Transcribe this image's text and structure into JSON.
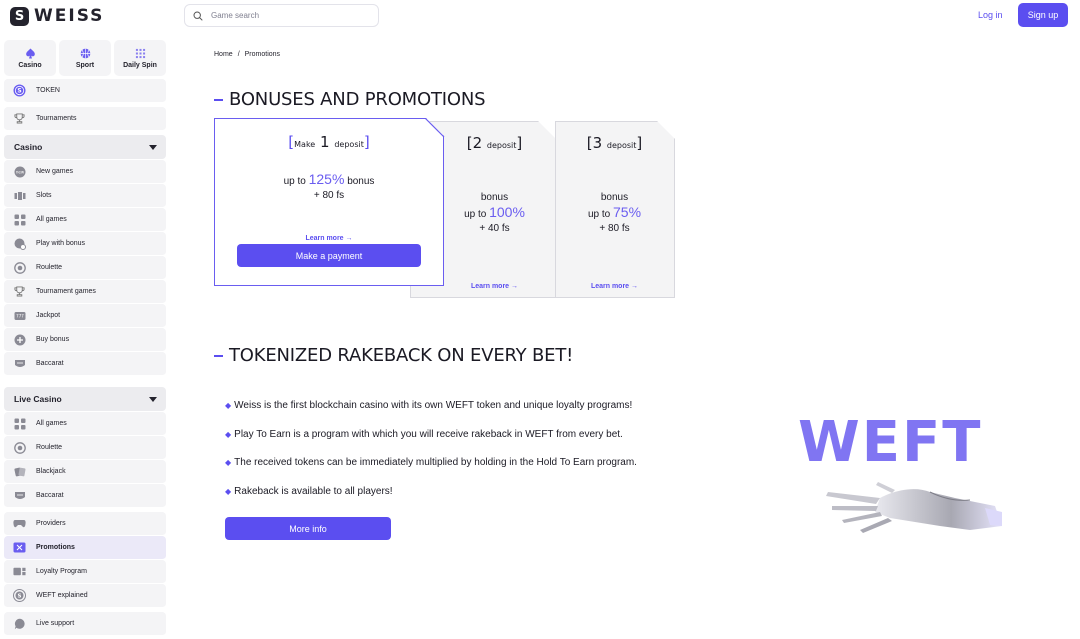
{
  "header": {
    "logo_text": "WEISS",
    "logo_letter": "S",
    "search_placeholder": "Game search",
    "login_label": "Log in",
    "signup_label": "Sign up"
  },
  "sidebar": {
    "tiles": [
      {
        "label": "Casino",
        "icon": "spade-icon"
      },
      {
        "label": "Sport",
        "icon": "basketball-icon"
      },
      {
        "label": "Daily Spin",
        "icon": "grid-dots-icon"
      }
    ],
    "token_label": "TOKEN",
    "tournaments_label": "Tournaments",
    "casino_heading": "Casino",
    "casino_items": [
      {
        "label": "New games",
        "icon": "new-icon"
      },
      {
        "label": "Slots",
        "icon": "slots-icon"
      },
      {
        "label": "All games",
        "icon": "grid-icon"
      },
      {
        "label": "Play with bonus",
        "icon": "bonus-icon"
      },
      {
        "label": "Roulette",
        "icon": "roulette-icon"
      },
      {
        "label": "Tournament games",
        "icon": "trophy-icon"
      },
      {
        "label": "Jackpot",
        "icon": "jackpot-icon"
      },
      {
        "label": "Buy bonus",
        "icon": "plus-circle-icon"
      },
      {
        "label": "Baccarat",
        "icon": "baccarat-icon"
      }
    ],
    "live_heading": "Live Casino",
    "live_items": [
      {
        "label": "All games",
        "icon": "grid-icon"
      },
      {
        "label": "Roulette",
        "icon": "roulette-icon"
      },
      {
        "label": "Blackjack",
        "icon": "cards-icon"
      },
      {
        "label": "Baccarat",
        "icon": "baccarat-icon"
      }
    ],
    "bottom_items": [
      {
        "label": "Providers",
        "icon": "gamepad-icon"
      },
      {
        "label": "Promotions",
        "icon": "promo-icon"
      },
      {
        "label": "Loyalty Program",
        "icon": "loyalty-icon"
      },
      {
        "label": "WEFT explained",
        "icon": "weft-coin-icon"
      },
      {
        "label": "Live support",
        "icon": "support-icon"
      }
    ]
  },
  "breadcrumb": {
    "home": "Home",
    "separator": "/",
    "current": "Promotions"
  },
  "bonuses": {
    "title": "BONUSES AND PROMOTIONS",
    "cards": [
      {
        "prefix": "Make",
        "number": "1",
        "suffix": "deposit",
        "line1_pre": "up to",
        "percent": "125%",
        "line1_post": "bonus",
        "line2": "+ 80 fs",
        "learn_more": "Learn more →",
        "button": "Make a payment"
      },
      {
        "number": "2",
        "suffix": "deposit",
        "line0": "bonus",
        "line1_pre": "up to",
        "percent": "100%",
        "line2": "+ 40 fs",
        "learn_more": "Learn more →"
      },
      {
        "number": "3",
        "suffix": "deposit",
        "line0": "bonus",
        "line1_pre": "up to",
        "percent": "75%",
        "line2": "+ 80 fs",
        "learn_more": "Learn more →"
      }
    ]
  },
  "rakeback": {
    "title": "TOKENIZED RAKEBACK ON EVERY BET!",
    "bullets": [
      "Weiss is the first blockchain casino with its own WEFT token and unique loyalty programs!",
      "Play To Earn is a program with which you will receive rakeback in WEFT from every bet.",
      "The received tokens can be immediately multiplied by holding in the Hold To Earn program.",
      "Rakeback is available to all players!"
    ],
    "button": "More info",
    "art_word": "WEFT"
  },
  "colors": {
    "accent": "#5b4ef0",
    "accent_light": "#8075f2",
    "sidebar_bg": "#f4f4f6",
    "text": "#1b1a24"
  }
}
